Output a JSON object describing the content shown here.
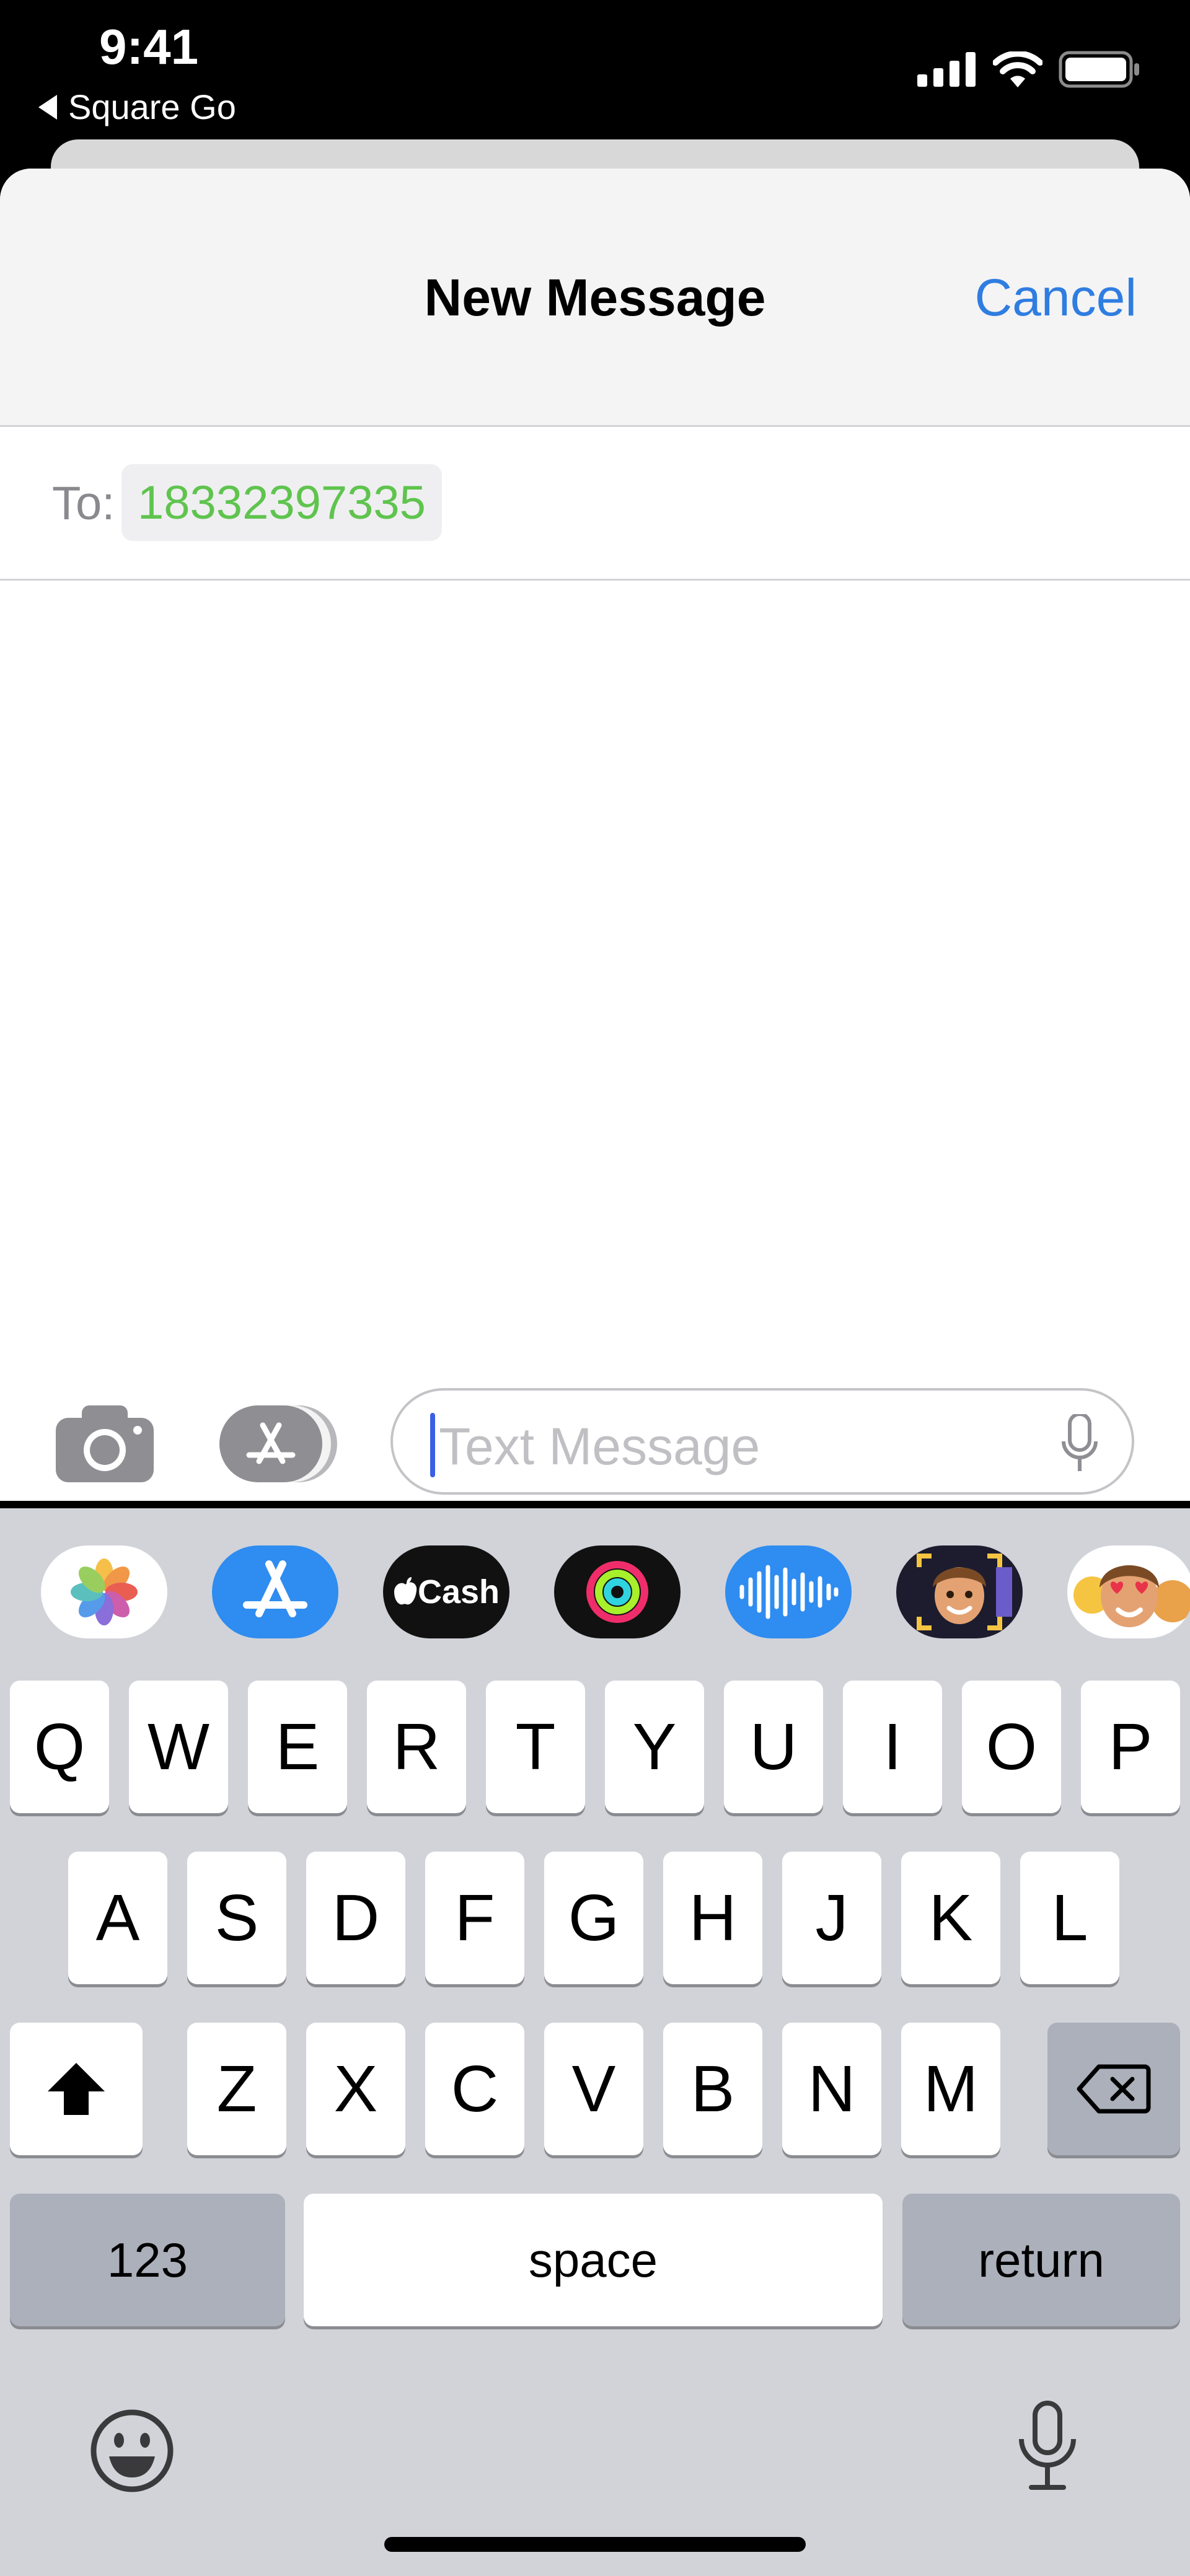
{
  "status_bar": {
    "time": "9:41",
    "back_app": "Square Go"
  },
  "nav": {
    "title": "New Message",
    "cancel_label": "Cancel"
  },
  "recipient": {
    "to_label": "To:",
    "value": "18332397335"
  },
  "composer": {
    "placeholder": "Text Message"
  },
  "app_tray": {
    "apple_cash_label": "Cash"
  },
  "keyboard": {
    "row1": [
      "Q",
      "W",
      "E",
      "R",
      "T",
      "Y",
      "U",
      "I",
      "O",
      "P"
    ],
    "row2": [
      "A",
      "S",
      "D",
      "F",
      "G",
      "H",
      "J",
      "K",
      "L"
    ],
    "row3": [
      "Z",
      "X",
      "C",
      "V",
      "B",
      "N",
      "M"
    ],
    "numbers_label": "123",
    "space_label": "space",
    "return_label": "return"
  },
  "colors": {
    "accent": "#2f7de1",
    "recipient": "#5fc44e",
    "caret": "#3a5fe5"
  }
}
